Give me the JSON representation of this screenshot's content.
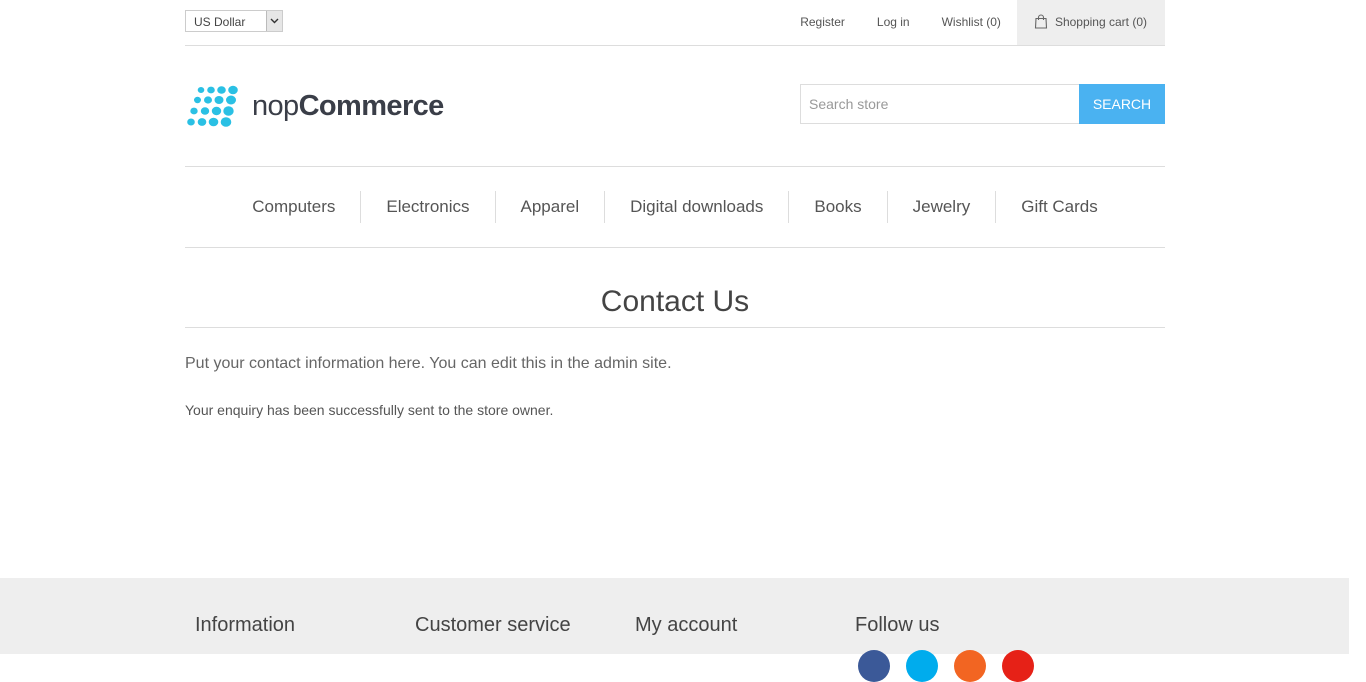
{
  "header": {
    "currency": "US Dollar",
    "links": {
      "register": "Register",
      "login": "Log in",
      "wishlist": "Wishlist (0)",
      "cart": "Shopping cart (0)"
    }
  },
  "logo": {
    "nop": "nop",
    "commerce": "Commerce"
  },
  "search": {
    "placeholder": "Search store",
    "button": "Search"
  },
  "nav": {
    "items": [
      "Computers",
      "Electronics",
      "Apparel",
      "Digital downloads",
      "Books",
      "Jewelry",
      "Gift Cards"
    ]
  },
  "page": {
    "title": "Contact Us",
    "topic": "Put your contact information here. You can edit this in the admin site.",
    "result": "Your enquiry has been successfully sent to the store owner."
  },
  "footer": {
    "columns": [
      "Information",
      "Customer service",
      "My account",
      "Follow us"
    ],
    "social_icons": [
      "facebook-icon",
      "twitter-icon",
      "rss-icon",
      "youtube-icon"
    ],
    "social_colors": [
      "#3b5998",
      "#00aced",
      "#f26522",
      "#e62117"
    ]
  },
  "colors": {
    "accent": "#4ab2f1",
    "logo_blue": "#2ac0e4"
  }
}
